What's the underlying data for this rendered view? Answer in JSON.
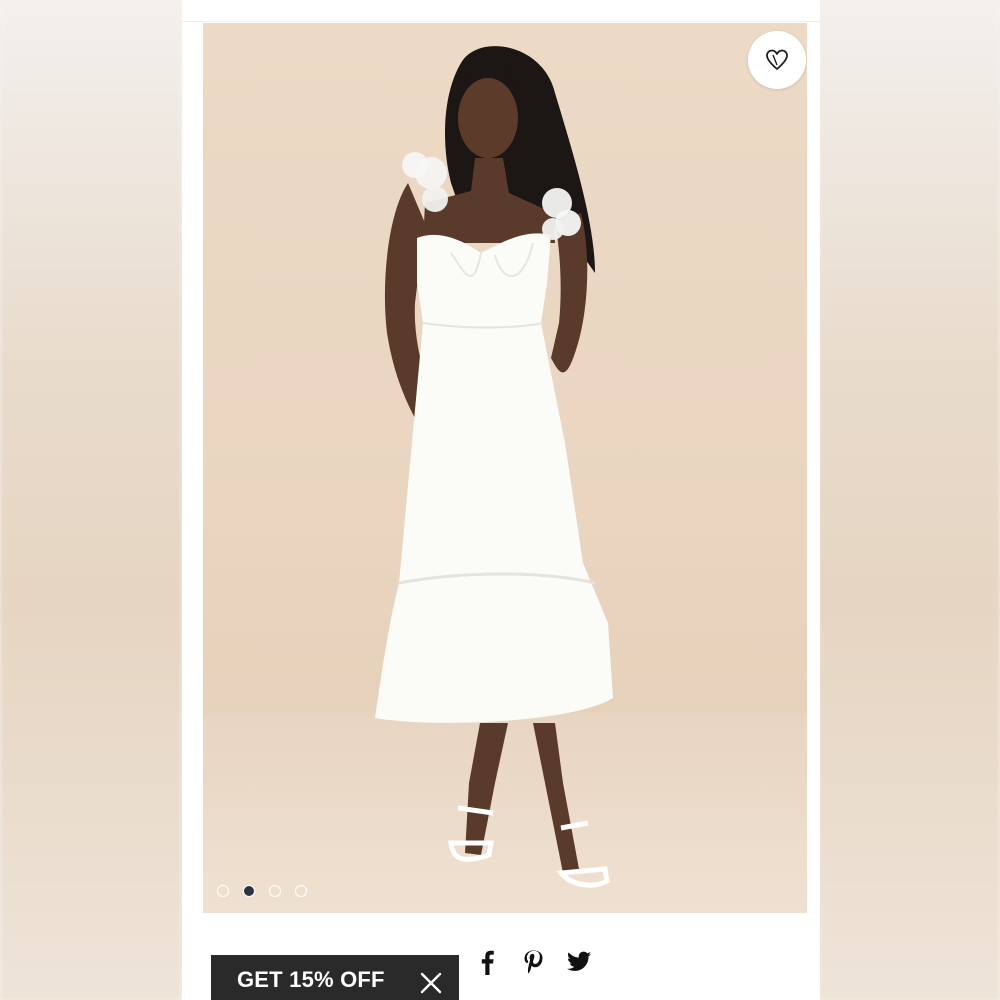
{
  "product_image": {
    "alt_visible": false,
    "slide_count": 4,
    "active_slide": 2
  },
  "favorite": {
    "icon": "heart-icon"
  },
  "promo": {
    "label": "GET 15% OFF",
    "close_icon": "close-icon"
  },
  "share": {
    "icons": [
      "facebook-icon",
      "pinterest-icon",
      "twitter-icon"
    ]
  },
  "colors": {
    "backdrop": "#e9d5c0",
    "promo_bg": "#2a2a2a",
    "active_dot": "#2b3540"
  }
}
